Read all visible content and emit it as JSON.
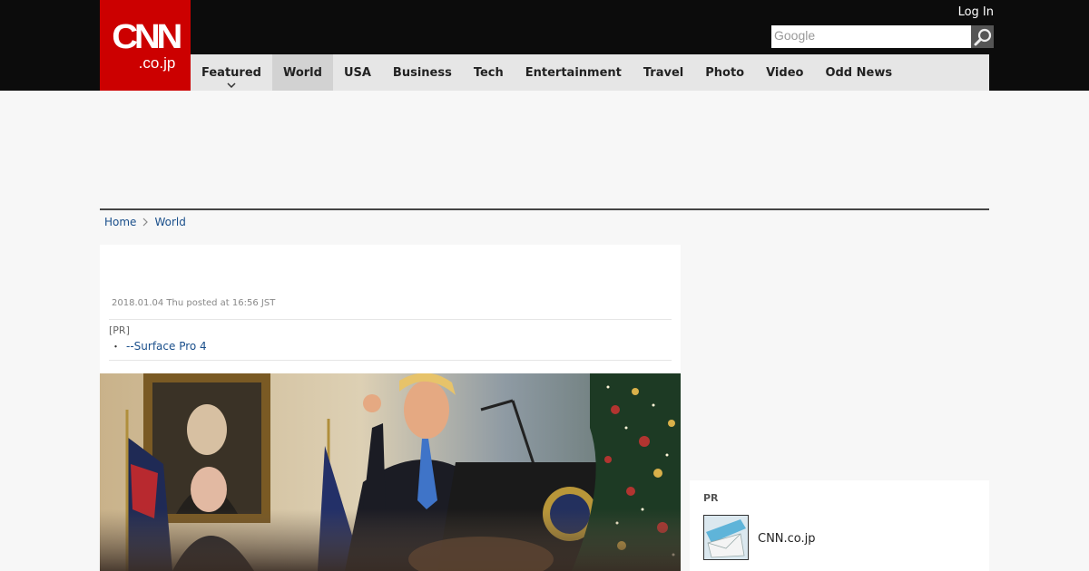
{
  "header": {
    "logo": {
      "brand": "CNN",
      "domain": ".co.jp"
    },
    "login_label": "Log In",
    "search": {
      "placeholder": "Google",
      "value": ""
    }
  },
  "nav": {
    "items": [
      {
        "label": "Featured",
        "has_dropdown": true
      },
      {
        "label": "World",
        "active": true
      },
      {
        "label": "USA"
      },
      {
        "label": "Business"
      },
      {
        "label": "Tech"
      },
      {
        "label": "Entertainment"
      },
      {
        "label": "Travel"
      },
      {
        "label": "Photo"
      },
      {
        "label": "Video"
      },
      {
        "label": "Odd News"
      }
    ]
  },
  "breadcrumb": {
    "home": "Home",
    "current": "World"
  },
  "article": {
    "posted": "2018.01.04 Thu posted at 16:56 JST",
    "pr_label": "[PR]",
    "pr_bullet": "・",
    "pr_link": "--Surface Pro 4"
  },
  "sidebar": {
    "pr_heading": "PR",
    "pr_item_label": "CNN.co.jp"
  },
  "colors": {
    "brand_red": "#cc0000",
    "topbar": "#0c0c0c",
    "nav_bg": "#e6e6e6",
    "nav_active": "#d2d2d2",
    "link": "#1a4f8b"
  }
}
